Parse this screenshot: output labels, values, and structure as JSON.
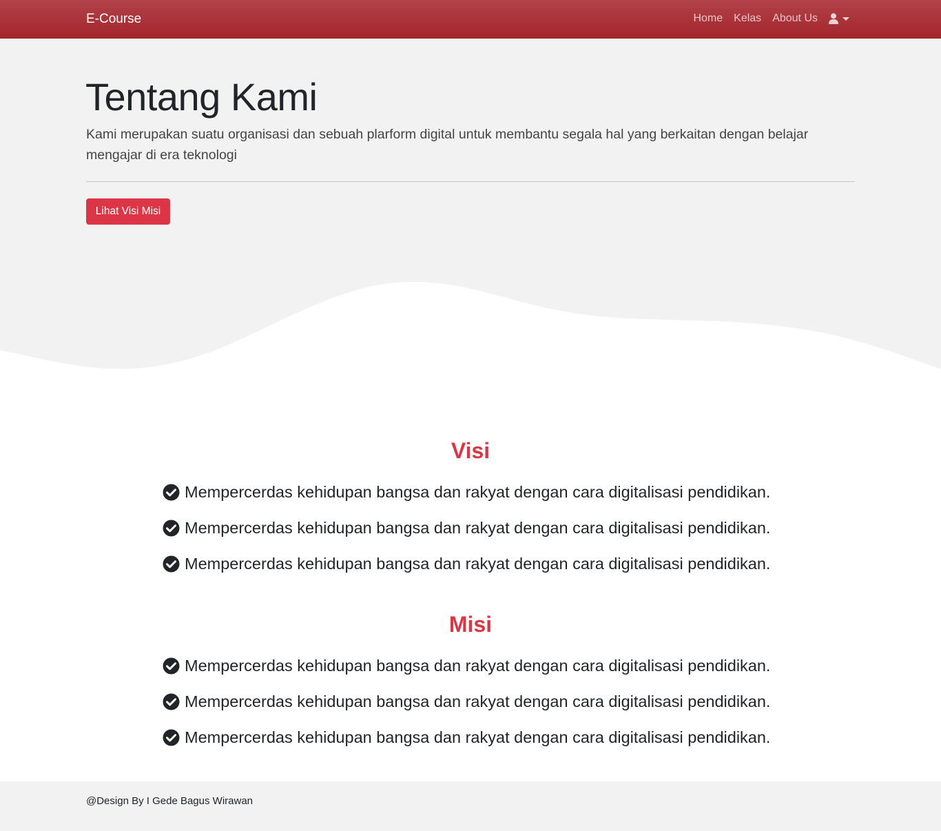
{
  "navbar": {
    "brand": "E-Course",
    "links": [
      "Home",
      "Kelas",
      "About Us"
    ],
    "user_icon": "user-icon",
    "caret_icon": "caret-down-icon"
  },
  "hero": {
    "title": "Tentang Kami",
    "lead": "Kami merupakan suatu organisasi dan sebuah plarform digital untuk membantu segala hal yang berkaitan dengan belajar mengajar di era teknologi",
    "button": "Lihat Visi Misi"
  },
  "visi": {
    "title": "Visi",
    "items": [
      "Mempercerdas kehidupan bangsa dan rakyat dengan cara digitalisasi pendidikan.",
      "Mempercerdas kehidupan bangsa dan rakyat dengan cara digitalisasi pendidikan.",
      "Mempercerdas kehidupan bangsa dan rakyat dengan cara digitalisasi pendidikan."
    ]
  },
  "misi": {
    "title": "Misi",
    "items": [
      "Mempercerdas kehidupan bangsa dan rakyat dengan cara digitalisasi pendidikan.",
      "Mempercerdas kehidupan bangsa dan rakyat dengan cara digitalisasi pendidikan.",
      "Mempercerdas kehidupan bangsa dan rakyat dengan cara digitalisasi pendidikan."
    ]
  },
  "footer": {
    "text": "@Design By I Gede Bagus Wirawan"
  },
  "colors": {
    "navbar": "#a3252b",
    "accent": "#dc3545",
    "jumbotron_bg": "#f2f2f2"
  }
}
